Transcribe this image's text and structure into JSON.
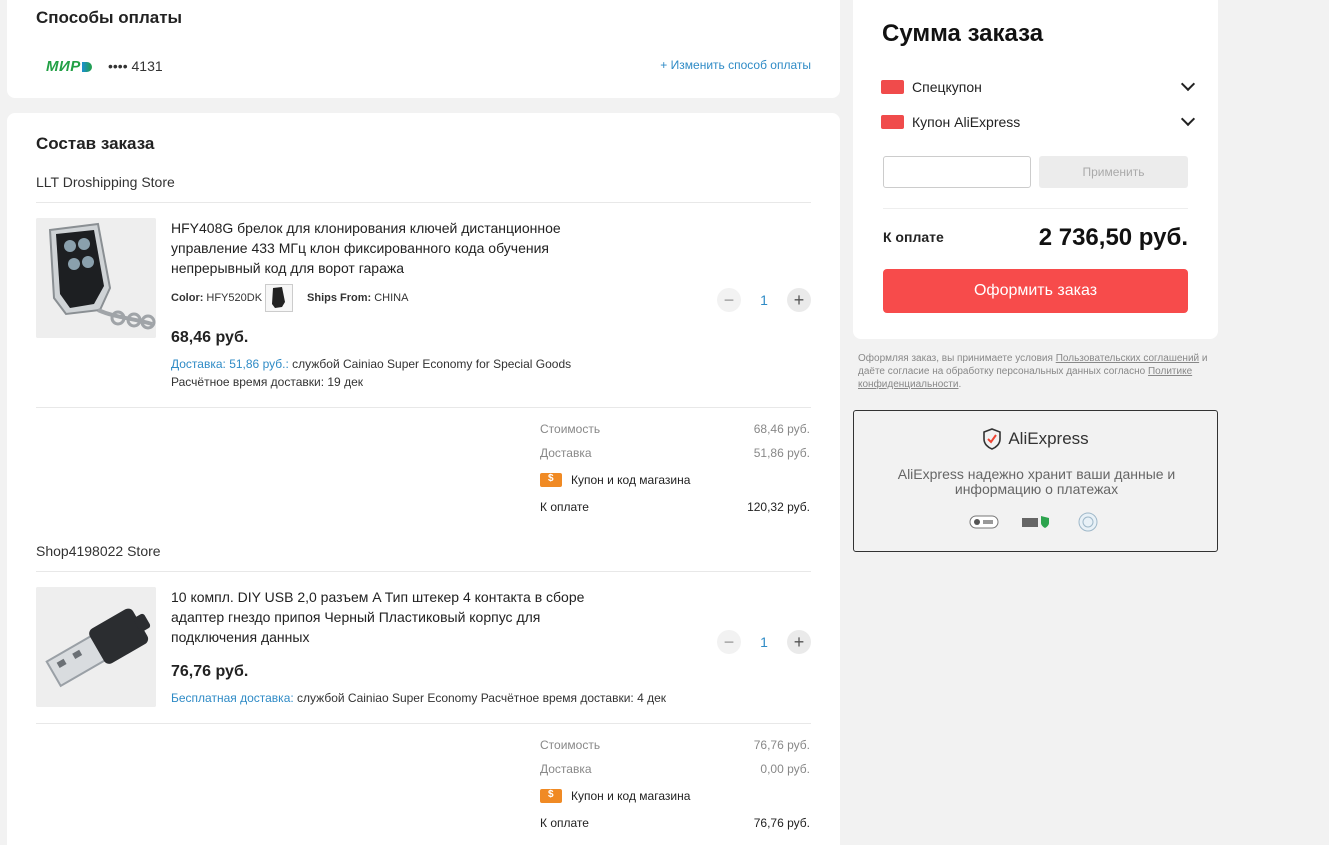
{
  "payment": {
    "title": "Способы оплаты",
    "card_brand": "МИР",
    "card_masked": "•••• 4131",
    "change_link": "+ Изменить способ оплаты"
  },
  "order": {
    "title": "Состав заказа",
    "stores": [
      {
        "name": "LLT Droshipping Store",
        "product": {
          "title": "HFY408G брелок для клонирования ключей дистанционное управление 433 МГц клон фиксированного кода обучения непрерывный код для ворот гаража",
          "color_label": "Color:",
          "color_value": "HFY520DK",
          "ships_label": "Ships From:",
          "ships_value": "CHINA",
          "price": "68,46 руб.",
          "delivery_link": "Доставка: 51,86 руб.:",
          "delivery_text": "службой Cainiao Super Economy for Special Goods",
          "eta": "Расчётное время доставки: 19 дек",
          "quantity": "1"
        },
        "summary": {
          "cost_label": "Стоимость",
          "cost_value": "68,46 руб.",
          "delivery_label": "Доставка",
          "delivery_value": "51,86 руб.",
          "coupon_label": "Купон и код магазина",
          "total_label": "К оплате",
          "total_value": "120,32 руб."
        }
      },
      {
        "name": "Shop4198022 Store",
        "product": {
          "title": "10 компл. DIY USB 2,0 разъем A Тип штекер 4 контакта в сборе адаптер гнездо припоя Черный Пластиковый корпус для подключения данных",
          "price": "76,76 руб.",
          "delivery_link": "Бесплатная доставка:",
          "delivery_text": "службой Cainiao Super Economy",
          "eta": "Расчётное время доставки: 4 дек",
          "quantity": "1"
        },
        "summary": {
          "cost_label": "Стоимость",
          "cost_value": "76,76 руб.",
          "delivery_label": "Доставка",
          "delivery_value": "0,00 руб.",
          "coupon_label": "Купон и код магазина",
          "total_label": "К оплате",
          "total_value": "76,76 руб."
        }
      }
    ]
  },
  "summary": {
    "title": "Сумма заказа",
    "special_coupon": "Спецкупон",
    "ae_coupon": "Купон AliExpress",
    "promo_placeholder": "",
    "apply_label": "Применить",
    "to_pay_label": "К оплате",
    "to_pay_amount": "2 736,50 руб.",
    "checkout_label": "Оформить заказ"
  },
  "terms": {
    "t1": "Оформляя заказ, вы принимаете условия ",
    "link1": "Пользовательских соглашений",
    "t2": " и даёте согласие на обработку персональных данных согласно ",
    "link2": "Политике конфиденциальности",
    "t3": "."
  },
  "trust": {
    "brand": "AliExpress",
    "text": "AliExpress надежно хранит ваши данные и информацию о платежах"
  },
  "colors": {
    "accent_red": "#f74b4b",
    "link_blue": "#2f8bc6",
    "mir_green": "#22a045",
    "coupon_orange": "#f08a24"
  }
}
